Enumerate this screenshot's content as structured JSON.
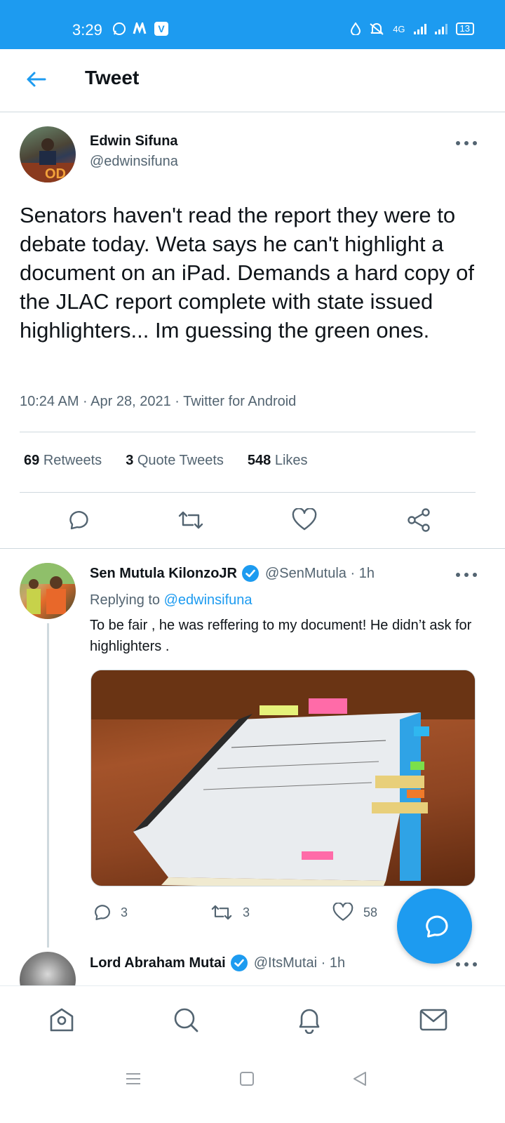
{
  "status_bar": {
    "time": "3:29",
    "network": "4G",
    "battery": "13"
  },
  "header": {
    "title": "Tweet"
  },
  "main_tweet": {
    "name": "Edwin Sifuna",
    "handle": "@edwinsifuna",
    "text": "Senators haven't read the report they were to debate today. Weta says he can't highlight a document on an iPad. Demands a  hard copy of the JLAC report complete with state issued highlighters... Im guessing the green ones.",
    "timestamp": "10:24 AM · Apr 28, 2021 · Twitter for Android",
    "retweets_count": "69",
    "retweets_label": "Retweets",
    "quotes_count": "3",
    "quotes_label": "Quote Tweets",
    "likes_count": "548",
    "likes_label": "Likes"
  },
  "reply": {
    "name": "Sen Mutula KilonzoJR",
    "handle_time": "@SenMutula · 1h",
    "replying_prefix": "Replying to",
    "replying_to": "@edwinsifuna",
    "text": "To be fair , he was reffering to my document! He didn’t ask for highlighters .",
    "reply_count": "3",
    "retweet_count": "3",
    "like_count": "58"
  },
  "reply2": {
    "name": "Lord Abraham Mutai",
    "handle_time": "@ItsMutai · 1h"
  },
  "colors": {
    "accent": "#1d9bf0",
    "secondary_text": "#536471",
    "border": "#cfd9de"
  }
}
